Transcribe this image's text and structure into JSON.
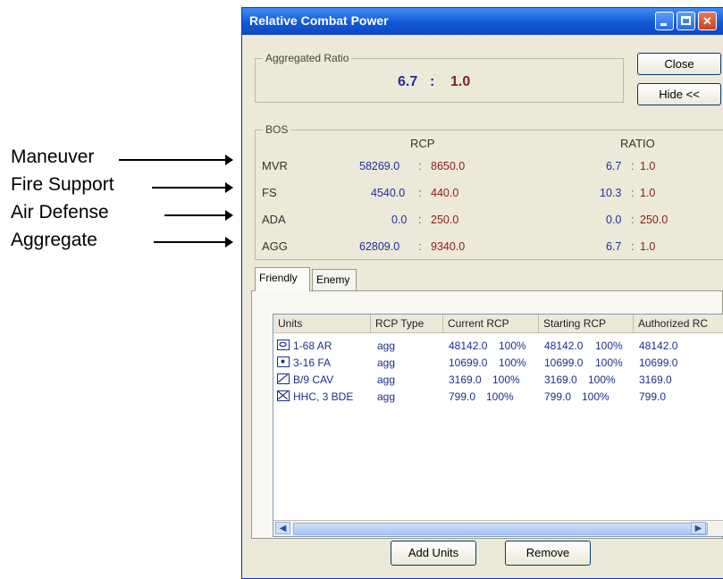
{
  "annotations": [
    "Maneuver",
    "Fire Support",
    "Air Defense",
    "Aggregate"
  ],
  "window": {
    "title": "Relative Combat Power",
    "controls": {
      "minimize_icon": "minimize-icon",
      "maximize_icon": "maximize-icon",
      "close_icon": "close-x-icon"
    }
  },
  "aggregated": {
    "legend": "Aggregated Ratio",
    "left": "6.7",
    "sep": ":",
    "right": "1.0"
  },
  "buttons": {
    "close": "Close",
    "hide": "Hide <<",
    "add_units": "Add Units",
    "remove": "Remove"
  },
  "bos": {
    "legend": "BOS",
    "rcp_header": "RCP",
    "ratio_header": "RATIO",
    "rows": [
      {
        "label": "MVR",
        "rcp_left": "58269.0",
        "rcp_right": "8650.0",
        "ratio_left": "6.7",
        "ratio_right": "1.0"
      },
      {
        "label": "FS",
        "rcp_left": "4540.0",
        "rcp_right": "440.0",
        "ratio_left": "10.3",
        "ratio_right": "1.0"
      },
      {
        "label": "ADA",
        "rcp_left": "0.0",
        "rcp_right": "250.0",
        "ratio_left": "0.0",
        "ratio_right": "250.0"
      },
      {
        "label": "AGG",
        "rcp_left": "62809.0",
        "rcp_right": "9340.0",
        "ratio_left": "6.7",
        "ratio_right": "1.0"
      }
    ]
  },
  "tabs": [
    "Friendly",
    "Enemy"
  ],
  "table": {
    "columns": [
      "Units",
      "RCP Type",
      "Current RCP",
      "Starting RCP",
      "Authorized RC"
    ],
    "rows": [
      {
        "unit": "1-68 AR",
        "icon": "armor-unit-icon",
        "type": "agg",
        "current": "48142.0",
        "current_pct": "100%",
        "starting": "48142.0",
        "starting_pct": "100%",
        "authorized": "48142.0"
      },
      {
        "unit": "3-16 FA",
        "icon": "artillery-unit-icon",
        "type": "agg",
        "current": "10699.0",
        "current_pct": "100%",
        "starting": "10699.0",
        "starting_pct": "100%",
        "authorized": "10699.0"
      },
      {
        "unit": "B/9 CAV",
        "icon": "cavalry-unit-icon",
        "type": "agg",
        "current": "3169.0",
        "current_pct": "100%",
        "starting": "3169.0",
        "starting_pct": "100%",
        "authorized": "3169.0"
      },
      {
        "unit": "HHC, 3 BDE",
        "icon": "infantry-unit-icon",
        "type": "agg",
        "current": "799.0",
        "current_pct": "100%",
        "starting": "799.0",
        "starting_pct": "100%",
        "authorized": "799.0"
      }
    ]
  },
  "scrollbar": {
    "left_icon": "scroll-left-icon",
    "right_icon": "scroll-right-icon"
  }
}
